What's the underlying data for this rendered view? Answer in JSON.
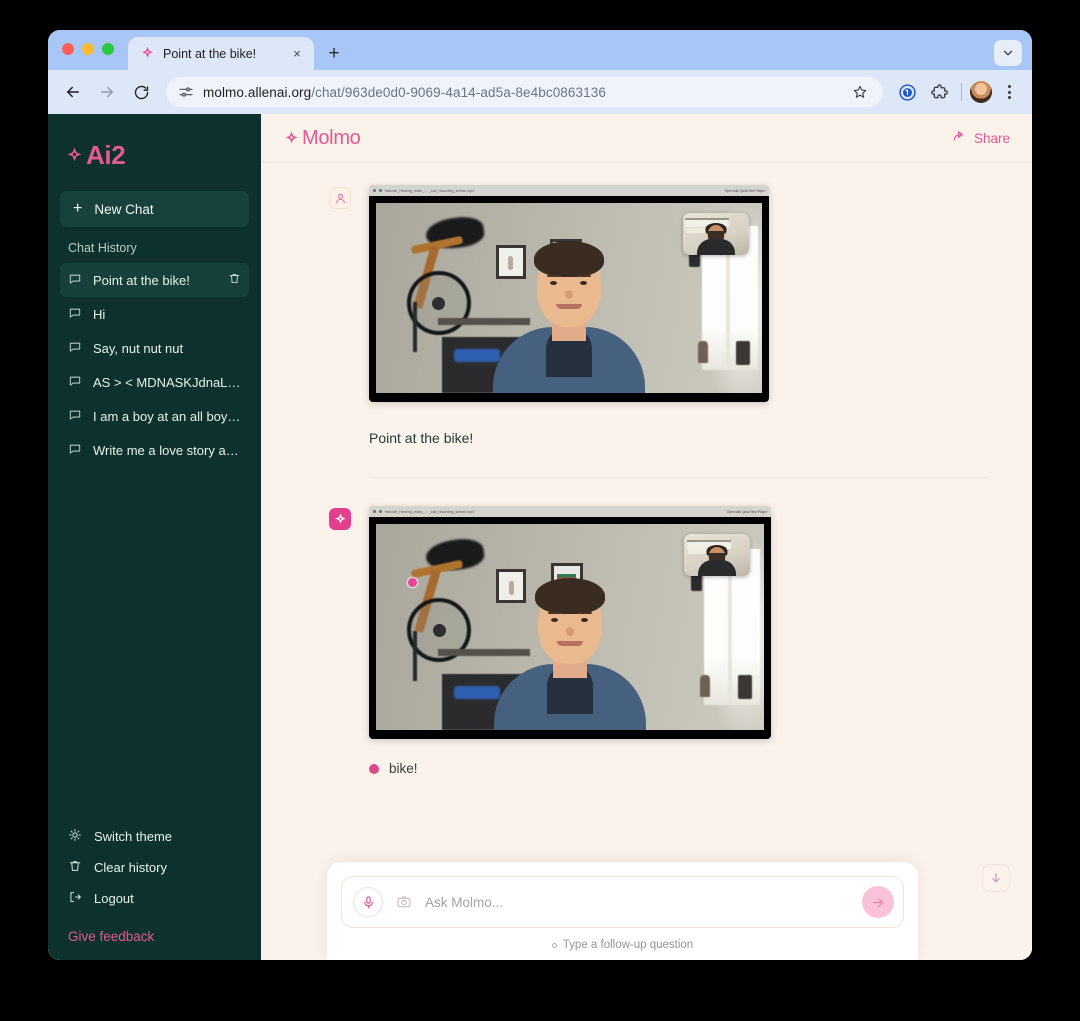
{
  "browser": {
    "tab": {
      "title": "Point at the bike!",
      "favicon": "molmo-star-favicon",
      "close_label": "×"
    },
    "new_tab_label": "+",
    "url_host": "molmo.allenai.org",
    "url_path": "/chat/963de0d0-9069-4a14-ad5a-8e4bc0863136",
    "toolbar_icons": [
      "back-icon",
      "forward-icon",
      "reload-icon",
      "site-settings-icon",
      "bookmark-star-icon",
      "password-manager-icon",
      "extensions-icon",
      "profile-avatar",
      "three-dot-menu-icon"
    ]
  },
  "sidebar": {
    "logo_text": "Ai2",
    "new_chat_label": "New Chat",
    "history_label": "Chat History",
    "history_items": [
      {
        "label": "Point at the bike!",
        "active": true
      },
      {
        "label": "Hi",
        "active": false
      },
      {
        "label": "Say, nut nut nut",
        "active": false
      },
      {
        "label": "AS > < MDNASKJdnaLKDJ…",
        "active": false
      },
      {
        "label": "I am a boy at an all boys …",
        "active": false
      },
      {
        "label": "Write me a love story ab…",
        "active": false
      }
    ],
    "bottom_items": [
      {
        "label": "Switch theme",
        "icon": "sun-icon"
      },
      {
        "label": "Clear history",
        "icon": "trash-icon"
      },
      {
        "label": "Logout",
        "icon": "logout-icon"
      }
    ],
    "feedback_label": "Give feedback"
  },
  "header": {
    "brand": "Molmo",
    "share_label": "Share"
  },
  "conversation": {
    "user_message": {
      "text": "Point at the bike!",
      "attachment_alt": "Screenshot of a video call: a man in a blue shirt with a bicycle hanging on the wall behind him"
    },
    "assistant_message": {
      "answer": "bike!",
      "attachment_alt": "Same video call screenshot with a pink point marker placed on the bicycle"
    }
  },
  "composer": {
    "placeholder": "Ask Molmo...",
    "value": "",
    "hint": "Type a follow-up question",
    "mic_icon": "microphone-icon",
    "camera_icon": "camera-icon",
    "send_icon": "arrow-right-icon"
  },
  "colors": {
    "accent_pink": "#e4598f",
    "sidebar_green": "#0d322e",
    "canvas_cream": "#fbf2ec",
    "point_marker": "#e8449a"
  }
}
